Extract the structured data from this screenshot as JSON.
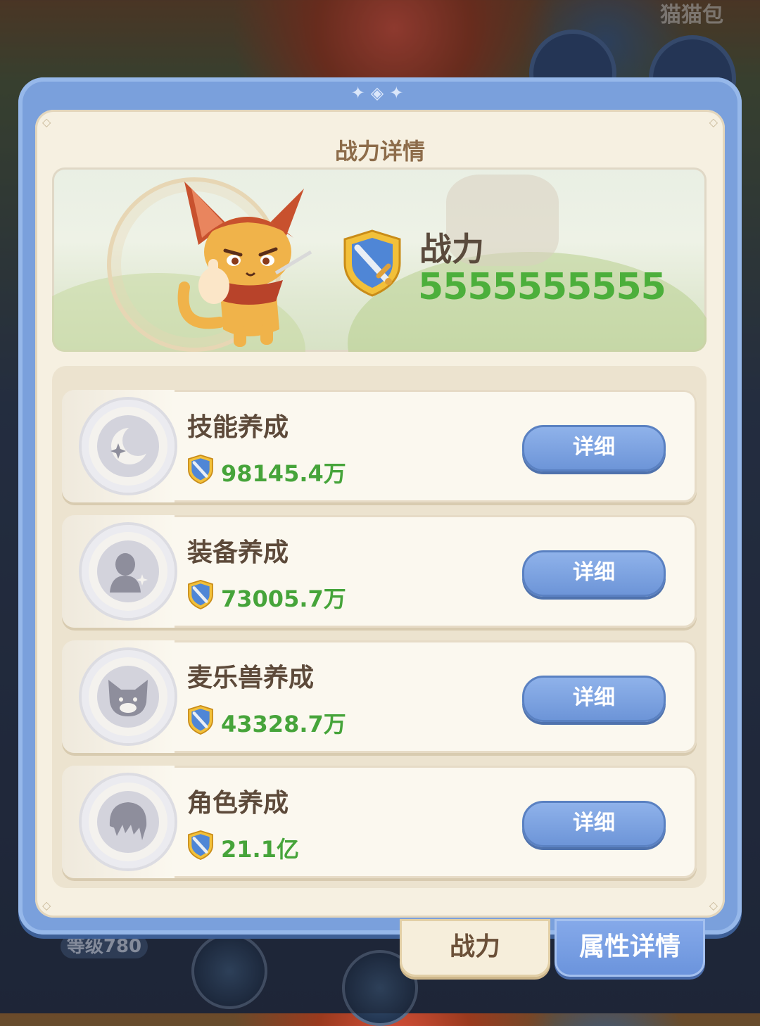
{
  "background": {
    "top_right_label": "猫猫包",
    "level_badge": "等级780"
  },
  "modal": {
    "title": "战力详情",
    "banner": {
      "power_label": "战力",
      "power_value": "5555555555"
    },
    "rows": [
      {
        "title": "技能养成",
        "value": "98145.4万",
        "button": "详细",
        "icon": "crescent-moon-sparkle-icon"
      },
      {
        "title": "装备养成",
        "value": "73005.7万",
        "button": "详细",
        "icon": "silhouette-sparkle-icon"
      },
      {
        "title": "麦乐兽养成",
        "value": "43328.7万",
        "button": "详细",
        "icon": "cat-face-icon"
      },
      {
        "title": "角色养成",
        "value": "21.1亿",
        "button": "详细",
        "icon": "hair-head-icon"
      }
    ]
  },
  "tabs": {
    "power": "战力",
    "attributes": "属性详情"
  },
  "colors": {
    "frame_blue": "#7aa0dc",
    "paper": "#f6f0e1",
    "value_green": "#46a43a",
    "button_blue": "#6d95d8"
  }
}
